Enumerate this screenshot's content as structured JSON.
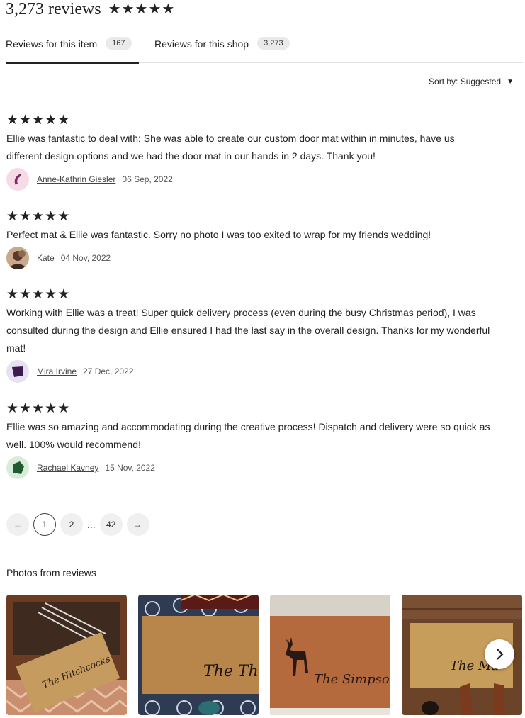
{
  "header": {
    "review_count": "3,273 reviews",
    "rating": 5
  },
  "tabs": [
    {
      "label": "Reviews for this item",
      "count": "167"
    },
    {
      "label": "Reviews for this shop",
      "count": "3,273"
    }
  ],
  "sort": {
    "label": "Sort by: Suggested",
    "caret": "▼"
  },
  "reviews": [
    {
      "rating": 5,
      "text": "Ellie was fantastic to deal with: She was able to create our custom door mat within in minutes, have us different design options and we had the door mat in our hands in 2 days. Thank you!",
      "author": "Anne-Kathrin Giesler",
      "date": "06 Sep, 2022",
      "avatar_color": "#7a2f63",
      "avatar_bg": "#f6dbe6"
    },
    {
      "rating": 5,
      "text": "Perfect mat & Ellie was fantastic. Sorry no photo I was too exited to wrap for my friends wedding!",
      "author": "Kate",
      "date": "04 Nov, 2022",
      "avatar_color": "#5b3a2c",
      "avatar_bg": "#c9a98c"
    },
    {
      "rating": 5,
      "text": "Working with Ellie was a treat! Super quick delivery process (even during the busy Christmas period), I was consulted during the design and Ellie ensured I had the last say in the overall design. Thanks for my wonderful mat!",
      "author": "Mira Irvine",
      "date": "27 Dec, 2022",
      "avatar_color": "#3b1a4f",
      "avatar_bg": "#e6e0f2"
    },
    {
      "rating": 5,
      "text": "Ellie was so amazing and accommodating during the creative process! Dispatch and delivery were so quick as well. 100% would recommend!",
      "author": "Rachael Kavney",
      "date": "15 Nov, 2022",
      "avatar_color": "#1f5a30",
      "avatar_bg": "#d9ecd9"
    }
  ],
  "pagination": {
    "prev": "←",
    "pages": [
      "1",
      "2"
    ],
    "ellipsis": "...",
    "last": "42",
    "next": "→",
    "current": "1"
  },
  "photos": {
    "title": "Photos from reviews",
    "items": [
      {
        "alt": "The Hitchcocks door mat",
        "mat_text": "The Hitchcocks"
      },
      {
        "alt": "The Thews door mat",
        "mat_text": "The Thews"
      },
      {
        "alt": "The Simpsons door mat with deer",
        "mat_text": "The Simpsons"
      },
      {
        "alt": "The Mas door mat",
        "mat_text": "The Ma"
      }
    ]
  },
  "colors": {
    "text": "#222222",
    "pill": "#eaeaea",
    "divider": "#e1e1e1"
  }
}
